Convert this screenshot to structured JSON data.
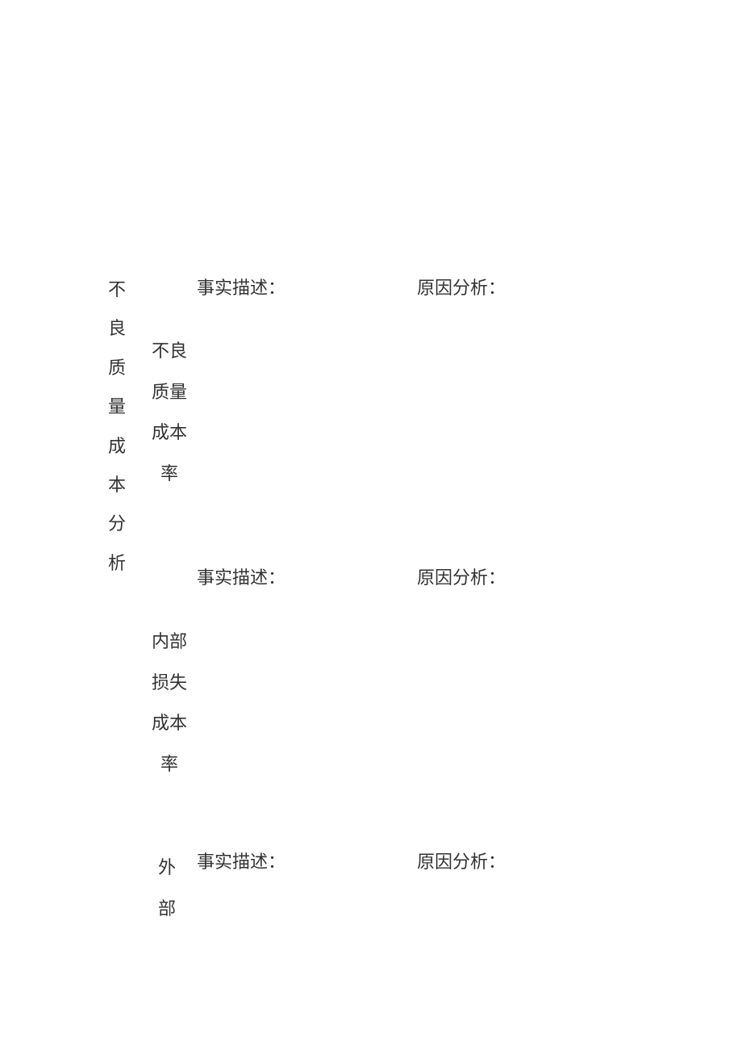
{
  "main_category": "不良质量成本分析",
  "sections": [
    {
      "name": "不良质量成本率",
      "fact_label": "事实描述：",
      "cause_label": "原因分析："
    },
    {
      "name": "内部损失成本率",
      "fact_label": "事实描述：",
      "cause_label": "原因分析："
    },
    {
      "name": "外部",
      "fact_label": "事实描述：",
      "cause_label": "原因分析："
    }
  ]
}
